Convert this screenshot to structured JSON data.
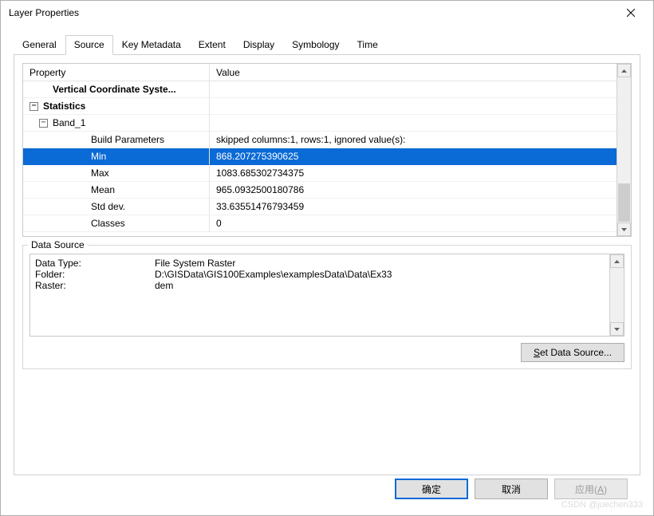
{
  "window": {
    "title": "Layer Properties"
  },
  "tabs": [
    {
      "label": "General"
    },
    {
      "label": "Source"
    },
    {
      "label": "Key Metadata"
    },
    {
      "label": "Extent"
    },
    {
      "label": "Display"
    },
    {
      "label": "Symbology"
    },
    {
      "label": "Time"
    }
  ],
  "active_tab_index": 1,
  "grid": {
    "header_property": "Property",
    "header_value": "Value",
    "rows": [
      {
        "name": "Vertical Coordinate Syste...",
        "value": "",
        "indent": 1,
        "bold": true,
        "toggle": null
      },
      {
        "name": "Statistics",
        "value": "",
        "indent": 0,
        "bold": true,
        "toggle": "minus"
      },
      {
        "name": "Band_1",
        "value": "",
        "indent": 1,
        "bold": false,
        "toggle": "minus"
      },
      {
        "name": "Build Parameters",
        "value": "skipped columns:1, rows:1, ignored value(s):",
        "indent": 3,
        "bold": false,
        "toggle": null
      },
      {
        "name": "Min",
        "value": "868.207275390625",
        "indent": 3,
        "bold": false,
        "toggle": null,
        "selected": true
      },
      {
        "name": "Max",
        "value": "1083.685302734375",
        "indent": 3,
        "bold": false,
        "toggle": null
      },
      {
        "name": "Mean",
        "value": "965.0932500180786",
        "indent": 3,
        "bold": false,
        "toggle": null
      },
      {
        "name": "Std dev.",
        "value": "33.63551476793459",
        "indent": 3,
        "bold": false,
        "toggle": null
      },
      {
        "name": "Classes",
        "value": "0",
        "indent": 3,
        "bold": false,
        "toggle": null
      }
    ]
  },
  "data_source": {
    "legend": "Data Source",
    "rows": [
      {
        "key": "Data Type:",
        "value": "File System Raster"
      },
      {
        "key": "Folder:",
        "value": "D:\\GISData\\GIS100Examples\\examplesData\\Data\\Ex33"
      },
      {
        "key": "Raster:",
        "value": "dem"
      }
    ],
    "set_button_prefix": "",
    "set_button_mnemonic": "S",
    "set_button_suffix": "et Data Source..."
  },
  "buttons": {
    "ok": "确定",
    "cancel": "取消",
    "apply_text": "应用(",
    "apply_mnemonic": "A",
    "apply_suffix": ")"
  },
  "watermark": "CSDN @juechen333"
}
